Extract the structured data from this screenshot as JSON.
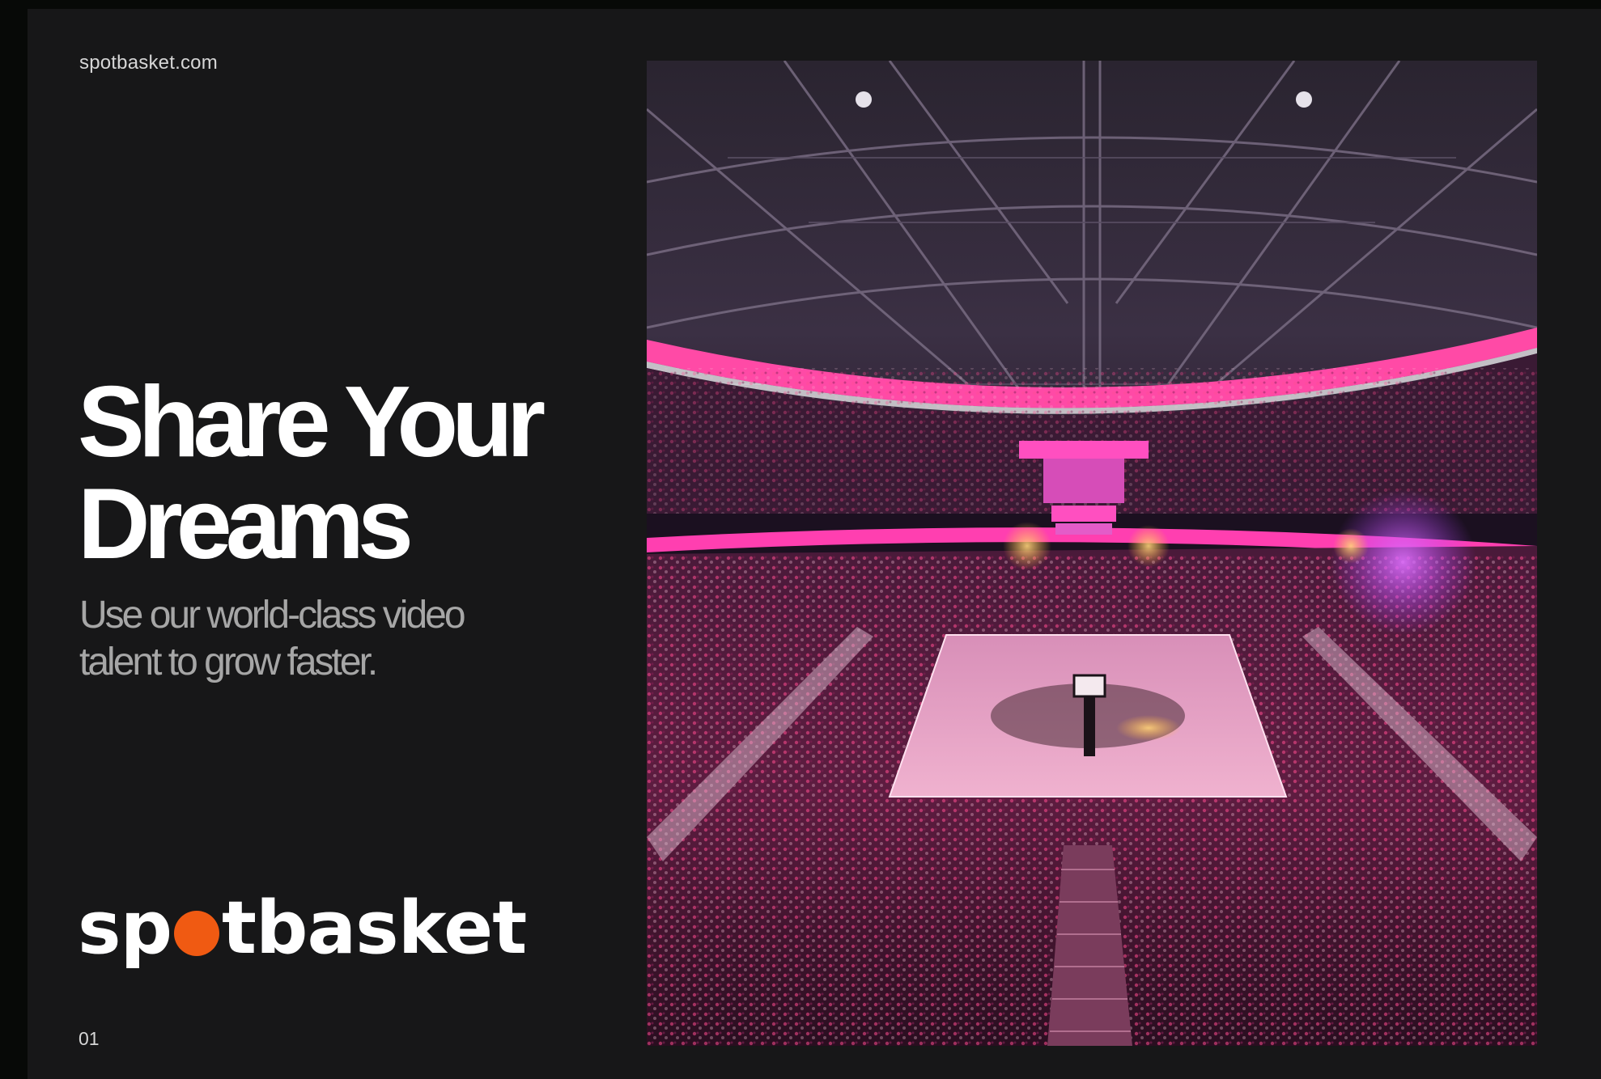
{
  "site_url": "spotbasket.com",
  "headline": {
    "line1": "Share Your",
    "line2": "Dreams"
  },
  "subhead": {
    "line1": "Use our world-class video",
    "line2": "talent to grow faster."
  },
  "logo": {
    "text_before_dot": "sp",
    "text_after_dot": "tbasket",
    "dot_color": "#f05a12"
  },
  "page_number": "01",
  "photo": {
    "subject": "basketball arena",
    "accent_colors": [
      "#ff3fb0",
      "#b23cff",
      "#ff6a2a"
    ]
  }
}
